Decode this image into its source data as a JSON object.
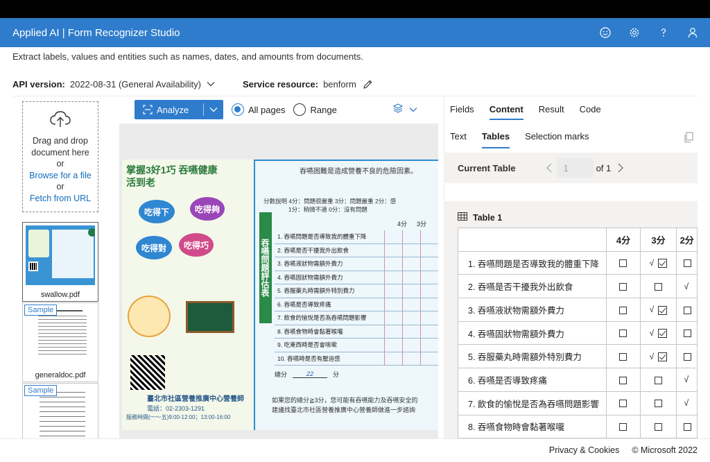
{
  "app": {
    "title": "Applied AI | Form Recognizer Studio",
    "icons": [
      "smiley-icon",
      "gear-icon",
      "help-icon",
      "person-icon"
    ]
  },
  "subtitle": "Extract labels, values and entities such as names, dates, and amounts from documents.",
  "api": {
    "label": "API version:",
    "value": "2022-08-31 (General Availability)",
    "service_label": "Service resource:",
    "service_value": "benform"
  },
  "dropzone": {
    "line1": "Drag and drop document here",
    "or1": "or",
    "browse": "Browse for a file",
    "or2": "or",
    "fetch": "Fetch from URL"
  },
  "files": [
    {
      "name": "swallow.pdf",
      "badge": ""
    },
    {
      "name": "generaldoc.pdf",
      "badge": "Sample"
    },
    {
      "name": "",
      "badge": "Sample"
    }
  ],
  "toolbar": {
    "analyze": "Analyze",
    "all_pages": "All pages",
    "range": "Range",
    "selected": "all_pages"
  },
  "rpanel": {
    "tabs": [
      "Fields",
      "Content",
      "Result",
      "Code"
    ],
    "active_tab": "Content",
    "subtabs": [
      "Text",
      "Tables",
      "Selection marks"
    ],
    "active_subtab": "Tables",
    "current_table_label": "Current Table",
    "page_value": "1",
    "of_label": "of 1",
    "table_title": "Table 1",
    "columns": [
      "",
      "4分",
      "3分",
      "2分"
    ],
    "rows": [
      {
        "label": "1. 吞嚥問題是否導致我的體重下降",
        "c4": "box",
        "c3": "check",
        "c3_mark": "√",
        "c2": "box"
      },
      {
        "label": "2. 吞嚥是否干擾我外出飲食",
        "c4": "box",
        "c3": "box",
        "c3_mark": "",
        "c2": "sqrt"
      },
      {
        "label": "3. 吞嚥液狀物需額外費力",
        "c4": "box",
        "c3": "check",
        "c3_mark": "√",
        "c2": "box"
      },
      {
        "label": "4. 吞嚥固狀物需額外費力",
        "c4": "box",
        "c3": "check",
        "c3_mark": "√",
        "c2": "box"
      },
      {
        "label": "5. 吞服藥丸時需額外特別費力",
        "c4": "box",
        "c3": "check",
        "c3_mark": "√",
        "c2": "box"
      },
      {
        "label": "6. 吞嚥是否導致疼痛",
        "c4": "box",
        "c3": "box",
        "c3_mark": "",
        "c2": "sqrt"
      },
      {
        "label": "7. 飲食的愉悅是否為吞嚥問題影響",
        "c4": "box",
        "c3": "box",
        "c3_mark": "",
        "c2": "sqrt"
      },
      {
        "label": "8. 吞嚥食物時會黏著喉嚨",
        "c4": "box",
        "c3": "box",
        "c3_mark": "",
        "c2": "box"
      }
    ]
  },
  "document_preview": {
    "heading": "掌握3好1巧 吞嚥健康 活到老",
    "bubbles": [
      "吃得下",
      "吃得夠",
      "吃得對",
      "吃得巧"
    ],
    "side_title": "吞嚥問題評估表",
    "question_header": "吞嚥困難是造成營養不良的危險因素。",
    "score_line": "分數說明 4分：問題很嚴重 3分：問題嚴重 2分：感",
    "score_line2": "1分：稍微不適 0分：沒有問題",
    "col4": "4分",
    "col3": "3分",
    "items": [
      "1. 吞嚥問題是否導致我的體重下降",
      "2. 吞嚥是否干擾我外出飲食",
      "3. 吞嚥液狀物需額外費力",
      "4. 吞嚥固狀物需額外費力",
      "5. 吞服藥丸時需額外特別費力",
      "6. 吞嚥是否導致疼痛",
      "7. 飲食的愉悅是否為吞嚥問題影響",
      "8. 吞嚥食物時會黏著喉嚨",
      "9. 吃東西時是否會咳嗽",
      "10. 吞嚥時是否有壓迫感"
    ],
    "total_label": "總分",
    "total_value": "22",
    "total_unit": "分",
    "advice": "如果您的總分≧3分，您可能有吞嚥能力及吞嚥安全的",
    "advice2": "建議找臺北市社區營養推廣中心營養師做進一步諮詢",
    "center_name": "臺北市社區營養推廣中心營養師",
    "phone": "電話：02-2303-1291",
    "hours": "服務時間(一～五)9:00-12:00；13:00-16:00"
  },
  "footer": {
    "privacy": "Privacy & Cookies",
    "copyright": "© Microsoft 2022"
  }
}
